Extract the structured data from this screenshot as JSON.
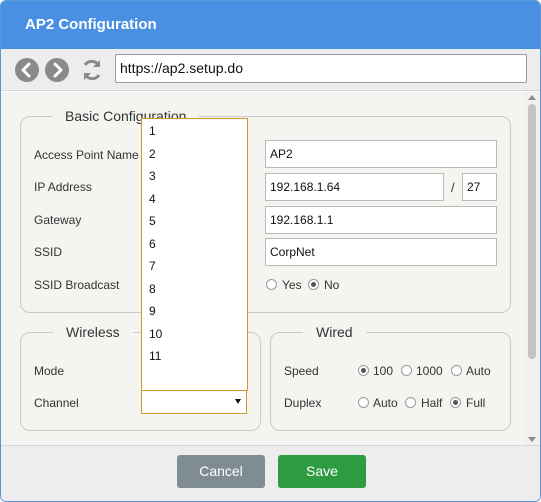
{
  "window": {
    "title": "AP2 Configuration"
  },
  "nav": {
    "url": "https://ap2.setup.do",
    "icons": [
      "back-icon",
      "forward-icon",
      "refresh-icon"
    ]
  },
  "basic": {
    "legend": "Basic Configuration",
    "ap_name_label": "Access Point Name",
    "ap_name_value": "AP2",
    "ip_label": "IP Address",
    "ip_value": "192.168.1.64",
    "ip_slash": "/",
    "ip_prefix": "27",
    "gateway_label": "Gateway",
    "gateway_value": "192.168.1.1",
    "ssid_label": "SSID",
    "ssid_value": "CorpNet",
    "broadcast_label": "SSID Broadcast",
    "broadcast_options": [
      "Yes",
      "No"
    ],
    "broadcast_selected": "No"
  },
  "wireless": {
    "legend": "Wireless",
    "mode_label": "Mode",
    "channel_label": "Channel",
    "channel_selected": "",
    "channel_options": [
      "1",
      "2",
      "3",
      "4",
      "5",
      "6",
      "7",
      "8",
      "9",
      "10",
      "11"
    ]
  },
  "wired": {
    "legend": "Wired",
    "speed_label": "Speed",
    "speed_options": [
      "100",
      "1000",
      "Auto"
    ],
    "speed_selected": "100",
    "duplex_label": "Duplex",
    "duplex_options": [
      "Auto",
      "Half",
      "Full"
    ],
    "duplex_selected": "Full"
  },
  "footer": {
    "cancel_label": "Cancel",
    "save_label": "Save"
  },
  "colors": {
    "titlebar": "#4a90e2",
    "save": "#2e9b40",
    "cancel": "#7f8c94",
    "select_border": "#d09a2a"
  }
}
